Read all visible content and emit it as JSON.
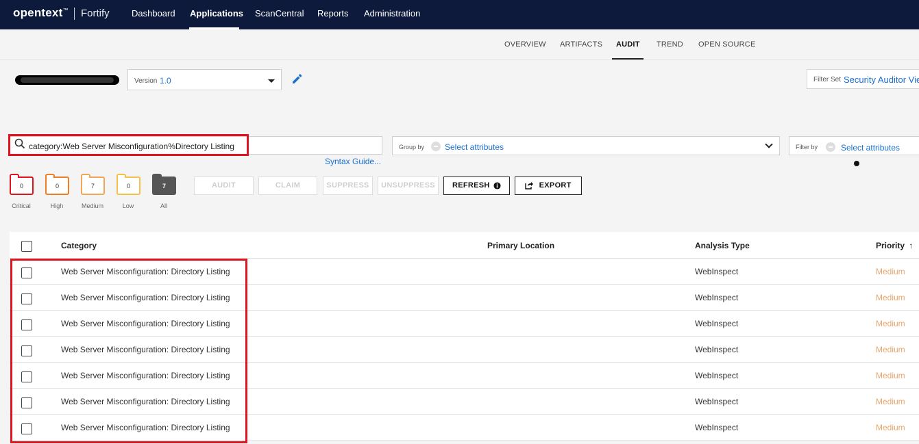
{
  "topnav": {
    "logo": "opentext",
    "logo_tm": "™",
    "product": "Fortify",
    "items": [
      {
        "label": "Dashboard"
      },
      {
        "label": "Applications"
      },
      {
        "label": "ScanCentral"
      },
      {
        "label": "Reports"
      },
      {
        "label": "Administration"
      }
    ],
    "active": "Applications"
  },
  "subnav": {
    "tabs": [
      {
        "label": "OVERVIEW"
      },
      {
        "label": "ARTIFACTS"
      },
      {
        "label": "AUDIT"
      },
      {
        "label": "TREND"
      },
      {
        "label": "OPEN SOURCE"
      }
    ],
    "active": "AUDIT"
  },
  "app": {
    "version_label": "Version",
    "version_value": "1.0",
    "filterset_label": "Filter Set",
    "filterset_value": "Security Auditor View"
  },
  "search": {
    "query": "category:Web Server Misconfiguration%Directory Listing",
    "syntax_link": "Syntax Guide..."
  },
  "groupby": {
    "label": "Group by",
    "value": "Select attributes"
  },
  "filterby": {
    "label": "Filter by",
    "value": "Select attributes"
  },
  "severity": [
    {
      "name": "Critical",
      "count": "0",
      "color": "#e0141e"
    },
    {
      "name": "High",
      "count": "0",
      "color": "#f07d22"
    },
    {
      "name": "Medium",
      "count": "7",
      "color": "#f2a65a"
    },
    {
      "name": "Low",
      "count": "0",
      "color": "#f3c04a"
    },
    {
      "name": "All",
      "count": "7",
      "color": "#555555"
    }
  ],
  "buttons": {
    "audit": "AUDIT",
    "claim": "CLAIM",
    "suppress": "SUPPRESS",
    "unsuppress": "UNSUPPRESS",
    "refresh": "REFRESH",
    "export": "EXPORT"
  },
  "table": {
    "headers": {
      "category": "Category",
      "location": "Primary Location",
      "analysis": "Analysis Type",
      "priority": "Priority"
    },
    "sort_indicator": "↑",
    "rows": [
      {
        "category": "Web Server Misconfiguration: Directory Listing",
        "location": "",
        "analysis": "WebInspect",
        "priority": "Medium"
      },
      {
        "category": "Web Server Misconfiguration: Directory Listing",
        "location": "",
        "analysis": "WebInspect",
        "priority": "Medium"
      },
      {
        "category": "Web Server Misconfiguration: Directory Listing",
        "location": "",
        "analysis": "WebInspect",
        "priority": "Medium"
      },
      {
        "category": "Web Server Misconfiguration: Directory Listing",
        "location": "",
        "analysis": "WebInspect",
        "priority": "Medium"
      },
      {
        "category": "Web Server Misconfiguration: Directory Listing",
        "location": "",
        "analysis": "WebInspect",
        "priority": "Medium"
      },
      {
        "category": "Web Server Misconfiguration: Directory Listing",
        "location": "",
        "analysis": "WebInspect",
        "priority": "Medium"
      },
      {
        "category": "Web Server Misconfiguration: Directory Listing",
        "location": "",
        "analysis": "WebInspect",
        "priority": "Medium"
      }
    ]
  },
  "colors": {
    "nav_bg": "#0e1a3c",
    "link": "#1a6fd0",
    "highlight": "#e0141e",
    "priority_medium": "#e8a56a"
  }
}
